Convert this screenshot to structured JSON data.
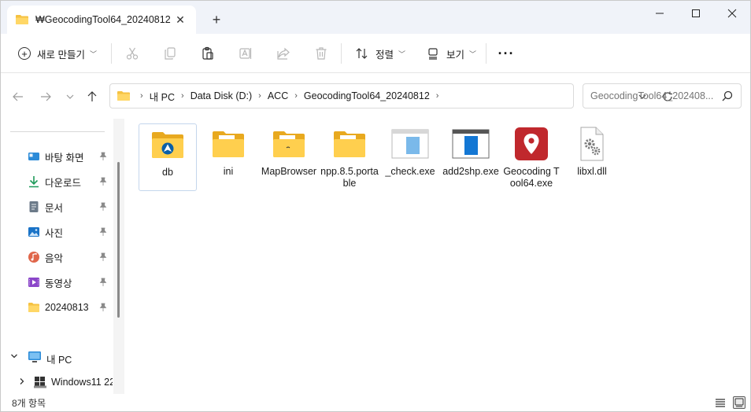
{
  "window": {
    "tab_title": "₩GeocodingTool64_20240812",
    "tab_close": "✕",
    "new_tab": "+"
  },
  "toolbar": {
    "new_label": "새로 만들기",
    "sort_label": "정렬",
    "view_label": "보기",
    "more_label": "···"
  },
  "address": {
    "crumbs": [
      "내 PC",
      "Data Disk (D:)",
      "ACC",
      "GeocodingTool64_20240812"
    ],
    "search_placeholder": "GeocodingTool64_202408..."
  },
  "sidebar": {
    "quick_access": [
      {
        "label": "바탕 화면",
        "icon": "desktop-icon"
      },
      {
        "label": "다운로드",
        "icon": "download-icon"
      },
      {
        "label": "문서",
        "icon": "document-icon"
      },
      {
        "label": "사진",
        "icon": "pictures-icon"
      },
      {
        "label": "음악",
        "icon": "music-icon"
      },
      {
        "label": "동영상",
        "icon": "video-icon"
      },
      {
        "label": "20240813",
        "icon": "folder-icon"
      }
    ],
    "this_pc": "내 PC",
    "drive": "Windows11 22"
  },
  "files": [
    {
      "name": "db",
      "type": "folder-special",
      "selected": true
    },
    {
      "name": "ini",
      "type": "folder"
    },
    {
      "name": "MapBrowser",
      "type": "folder"
    },
    {
      "name": "npp.8.5.portable",
      "type": "folder"
    },
    {
      "name": "_check.exe",
      "type": "exe-window"
    },
    {
      "name": "add2shp.exe",
      "type": "exe-window-dark"
    },
    {
      "name": "Geocoding Tool64.exe",
      "type": "exe-map"
    },
    {
      "name": "libxl.dll",
      "type": "dll"
    }
  ],
  "status": {
    "item_count": "8개 항목"
  },
  "colors": {
    "folder": "#f5c242",
    "accent": "#0a64c0",
    "geocode_red": "#c0282d"
  }
}
